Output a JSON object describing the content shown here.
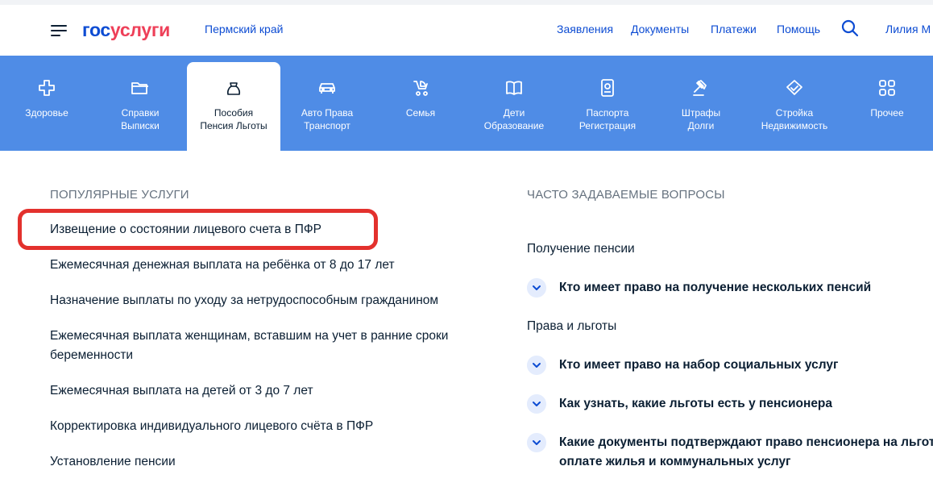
{
  "header": {
    "logo_part1": "гос",
    "logo_part2": "услуги",
    "region": "Пермский край",
    "nav": [
      "Заявления",
      "Документы",
      "Платежи",
      "Помощь"
    ],
    "user": "Лилия М"
  },
  "categories": [
    {
      "line1": "Здоровье",
      "line2": "",
      "icon": "health-cross-icon"
    },
    {
      "line1": "Справки",
      "line2": "Выписки",
      "icon": "folder-icon"
    },
    {
      "line1": "Пособия",
      "line2": "Пенсия Льготы",
      "icon": "wallet-icon"
    },
    {
      "line1": "Авто Права",
      "line2": "Транспорт",
      "icon": "car-icon"
    },
    {
      "line1": "Семья",
      "line2": "",
      "icon": "stroller-icon"
    },
    {
      "line1": "Дети",
      "line2": "Образование",
      "icon": "book-icon"
    },
    {
      "line1": "Паспорта",
      "line2": "Регистрация",
      "icon": "passport-icon"
    },
    {
      "line1": "Штрафы",
      "line2": "Долги",
      "icon": "gavel-icon"
    },
    {
      "line1": "Стройка",
      "line2": "Недвижимость",
      "icon": "house-icon"
    },
    {
      "line1": "Прочее",
      "line2": "",
      "icon": "grid-icon"
    }
  ],
  "popular": {
    "title": "ПОПУЛЯРНЫЕ УСЛУГИ",
    "items": [
      "Извещение о состоянии лицевого счета в ПФР",
      "Ежемесячная денежная выплата на ребёнка от 8 до 17 лет",
      "Назначение выплаты по уходу за нетрудоспособным гражданином",
      "Ежемесячная выплата женщинам, вставшим на учет в ранние сроки",
      "беременности",
      "Ежемесячная выплата на детей от 3 до 7 лет",
      "Корректировка индивидуального лицевого счёта в ПФР",
      "Установление пенсии"
    ]
  },
  "faq": {
    "title": "ЧАСТО ЗАДАВАЕМЫЕ ВОПРОСЫ",
    "cat1": "Получение пенсии",
    "cat2": "Права и льготы",
    "q1": "Кто имеет право на получение нескольких пенсий",
    "q2": "Кто имеет право на набор социальных услуг",
    "q3": "Как узнать, какие льготы есть у пенсионера",
    "q4_line1": "Какие документы подтверждают право пенсионера на льготы",
    "q4_line2": "оплате жилья и коммунальных услуг"
  },
  "colors": {
    "brand_blue": "#0d4cd3",
    "brand_red": "#ee3f58",
    "category_bar": "#4f8ce6",
    "highlight": "#e3312d"
  }
}
